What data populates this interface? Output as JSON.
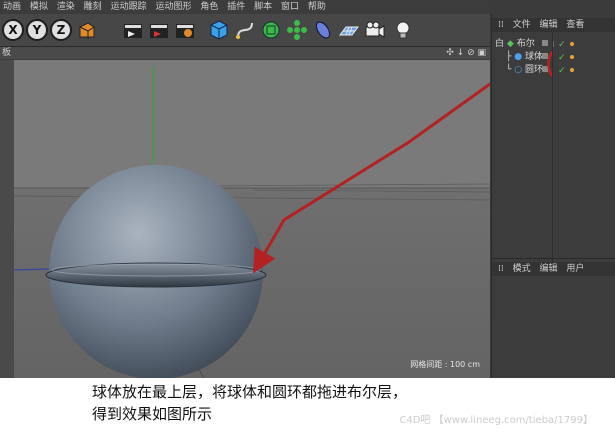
{
  "menubar": {
    "items": [
      "动画",
      "模拟",
      "渲染",
      "雕刻",
      "运动跟踪",
      "运动图形",
      "角色",
      "插件",
      "脚本",
      "窗口",
      "帮助"
    ]
  },
  "toolbar": {
    "axis_x": "X",
    "axis_y": "Y",
    "axis_z": "Z"
  },
  "viewport": {
    "header_label": "板",
    "nav_icons": "✣ ↓ ⊘ ▣",
    "grid_distance": "网格间距 : 100 cm"
  },
  "object_manager": {
    "menu": [
      "文件",
      "编辑",
      "查看"
    ],
    "objects": [
      {
        "label": "布尔",
        "prefix": "白"
      },
      {
        "label": "球体"
      },
      {
        "label": "圆环"
      }
    ]
  },
  "attribute_manager": {
    "menu": [
      "模式",
      "编辑",
      "用户"
    ]
  },
  "caption": {
    "line1": "球体放在最上层，将球体和圆环都拖进布尔层，",
    "line2": "得到效果如图所示"
  },
  "watermark": "C4D吧 【www.lineeg.com/tieba/1799】",
  "colors": {
    "arrow": "#b22222",
    "ui_bg": "#3b3b3b",
    "viewport_bg": "#707070",
    "sphere": "#6f7d8c"
  }
}
